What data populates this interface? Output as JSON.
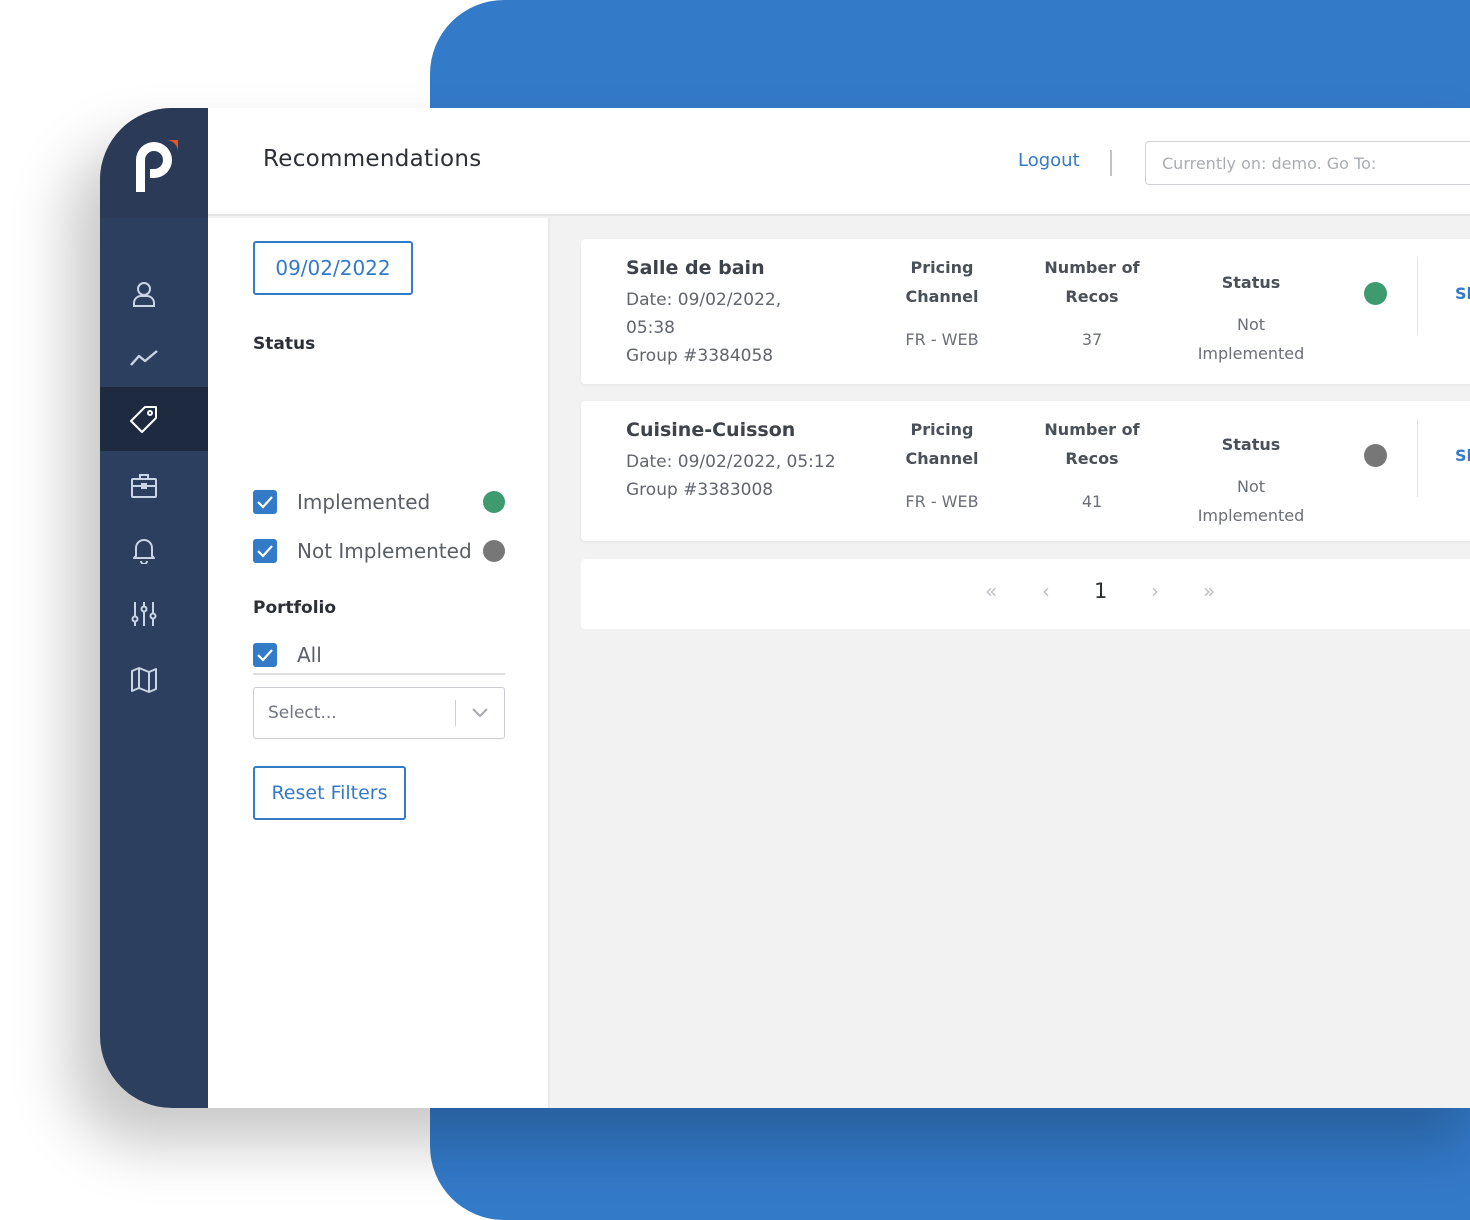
{
  "colors": {
    "accent": "#337ac9",
    "sidebar": "#2d3f5e",
    "implemented_dot": "#3e9a6f",
    "not_implemented_dot": "#777777"
  },
  "sidebar": {
    "items": [
      {
        "icon": "user-icon"
      },
      {
        "icon": "trend-chart-icon"
      },
      {
        "icon": "price-tag-icon",
        "active": true
      },
      {
        "icon": "briefcase-icon"
      },
      {
        "icon": "bell-icon"
      },
      {
        "icon": "sliders-icon"
      },
      {
        "icon": "map-icon"
      }
    ]
  },
  "header": {
    "title": "Recommendations",
    "logout": "Logout",
    "goto_placeholder": "Currently on: demo. Go To:"
  },
  "filters": {
    "date": "09/02/2022",
    "status_title": "Status",
    "status_options": [
      {
        "label": "Implemented",
        "checked": true
      },
      {
        "label": "Not Implemented",
        "checked": true
      }
    ],
    "portfolio_title": "Portfolio",
    "portfolio_all": {
      "label": "All",
      "checked": true
    },
    "select_placeholder": "Select...",
    "reset_label": "Reset Filters"
  },
  "recommendations": [
    {
      "name": "Salle de bain",
      "date_line1": "Date: 09/02/2022,",
      "date_line2": "05:38",
      "group": "Group #3384058",
      "channel_header1": "Pricing",
      "channel_header2": "Channel",
      "channel": "FR - WEB",
      "recos_header1": "Number of",
      "recos_header2": "Recos",
      "recos": "37",
      "status_header": "Status",
      "status_line1": "Not",
      "status_line2": "Implemented",
      "link_text": "Sl"
    },
    {
      "name": "Cuisine-Cuisson",
      "date_line1": "Date: 09/02/2022, 05:12",
      "group": "Group #3383008",
      "channel_header1": "Pricing",
      "channel_header2": "Channel",
      "channel": "FR - WEB",
      "recos_header1": "Number of",
      "recos_header2": "Recos",
      "recos": "41",
      "status_header": "Status",
      "status_line1": "Not",
      "status_line2": "Implemented",
      "link_text": "Sl"
    }
  ],
  "pagination": {
    "first": "«",
    "prev": "‹",
    "current": "1",
    "next": "›",
    "last": "»"
  }
}
